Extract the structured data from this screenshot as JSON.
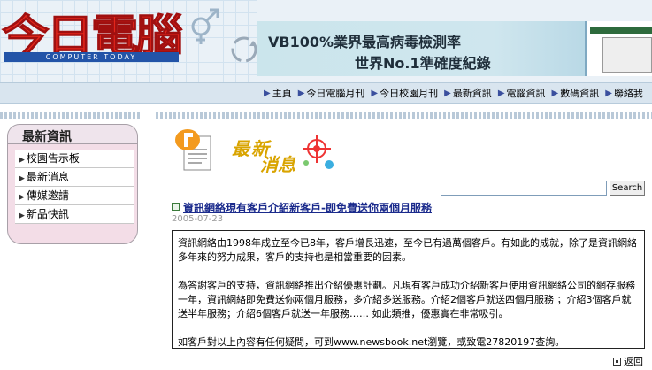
{
  "header": {
    "logo_text": "今日電腦",
    "logo_subtitle": "COMPUTER TODAY",
    "banner": {
      "line1": "VB100%業界最高病毒檢測率",
      "line2": "世界No.1準確度紀錄"
    }
  },
  "nav": {
    "items": [
      {
        "label": "主頁"
      },
      {
        "label": "今日電腦月刊"
      },
      {
        "label": "今日校園月刊"
      },
      {
        "label": "最新資訊"
      },
      {
        "label": "電腦資訊"
      },
      {
        "label": "數碼資訊"
      },
      {
        "label": "聯絡我"
      }
    ]
  },
  "sidebar": {
    "title": "最新資訊",
    "items": [
      {
        "label": "校園告示板"
      },
      {
        "label": "最新消息"
      },
      {
        "label": "傳媒邀請"
      },
      {
        "label": "新品快訊"
      }
    ]
  },
  "news_header": {
    "logo_line1": "最新",
    "logo_line2": "消息"
  },
  "search": {
    "value": "",
    "button_label": "Search"
  },
  "article": {
    "title": "資訊網絡現有客戶介紹新客戶-即免費送你兩個月服務",
    "date": "2005-07-23",
    "paragraphs": [
      "資訊網絡由1998年成立至今已8年，客戶增長迅速，至今已有過萬個客戶。有如此的成就，除了是資訊網絡多年來的努力成果，客戶的支持也是相當重要的因素。",
      "為答謝客戶的支持，資訊網絡推出介紹優惠計劃。凡現有客戶成功介紹新客戶使用資訊網絡公司的網存服務一年，資訊網絡即免費送你兩個月服務，多介紹多送服務。介紹2個客戶就送四個月服務 ；介紹3個客戶就送半年服務；介紹6個客戶就送一年服務…… 如此類推，優惠實在非常吸引。",
      "如客戶對以上內容有任何疑問，可到www.newsbook.net瀏覽，或致電27820197查詢。"
    ],
    "back_label": "返回"
  },
  "colors": {
    "logo_red": "#e4261b",
    "logo_blue": "#2354a8",
    "nav_bg": "#d9e5ef",
    "sidebar_pink": "#f3dde7",
    "title_link": "#1a2a8c"
  }
}
